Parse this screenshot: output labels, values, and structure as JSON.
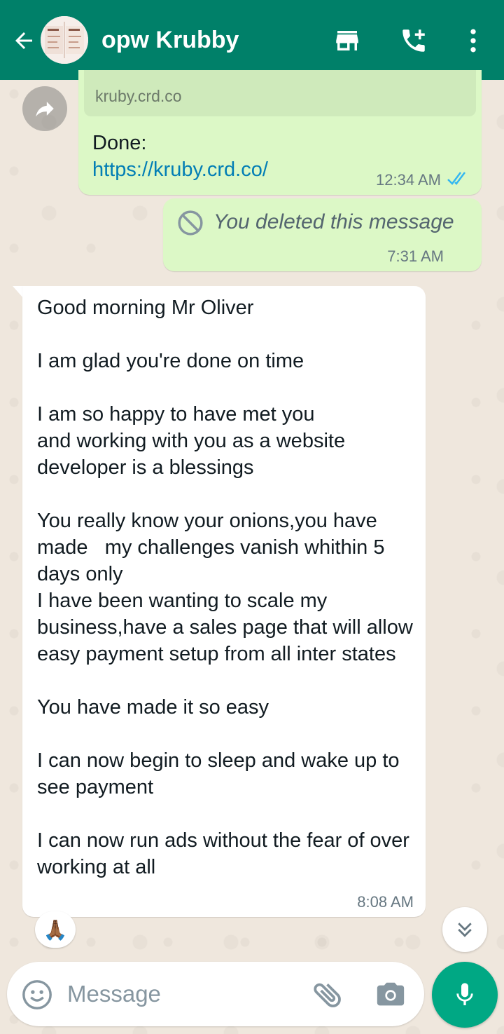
{
  "header": {
    "contact_name": "opw Krubby",
    "icons": [
      "arrow-left-icon",
      "storefront-icon",
      "phone-add-icon",
      "more-vert-icon"
    ],
    "color": "#008069"
  },
  "messages": [
    {
      "direction": "outgoing",
      "link_preview_domain": "kruby.crd.co",
      "text_line1": "Done:",
      "link": "https://kruby.crd.co/",
      "time": "12:34 AM",
      "status": "read"
    },
    {
      "direction": "outgoing",
      "deleted_text": "You deleted this message",
      "time": "7:31 AM"
    },
    {
      "direction": "incoming",
      "text": "Good morning Mr Oliver\n\nI am glad you're done on time\n\nI am so happy to have met you\nand working with you as a website developer is a blessings\n\nYou really know your onions,you have made   my challenges vanish whithin 5 days only\nI have been wanting to scale my business,have a sales page that will allow easy payment setup from all inter states\n\nYou have made it so easy\n\nI can now begin to sleep and wake up to see payment\n\nI can now run ads without the fear of over working at all",
      "time": "8:08 AM",
      "reaction": "🙏🏾"
    }
  ],
  "composer": {
    "placeholder": "Message",
    "icons": [
      "emoji-icon",
      "paperclip-icon",
      "camera-icon",
      "mic-icon"
    ]
  },
  "colors": {
    "outgoing_bubble": "#dcf8c6",
    "incoming_bubble": "#ffffff",
    "link": "#027eb5",
    "read_ticks": "#34b7f1",
    "accent": "#00a884"
  }
}
